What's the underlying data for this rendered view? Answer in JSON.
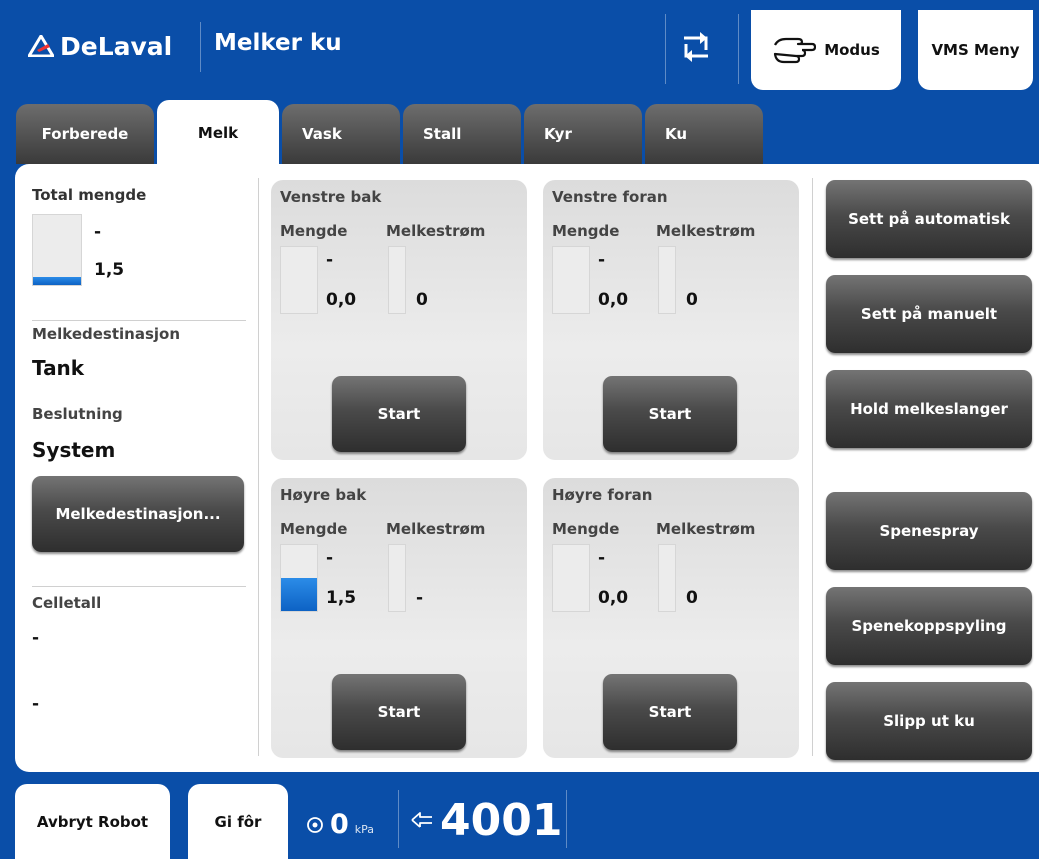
{
  "header": {
    "brand": "DeLaval",
    "title": "Melker ku",
    "modus_label": "Modus",
    "vms_menu_label": "VMS Meny"
  },
  "tabs": [
    {
      "label": "Forberede",
      "active": false
    },
    {
      "label": "Melk",
      "active": true
    },
    {
      "label": "Vask",
      "active": false
    },
    {
      "label": "Stall",
      "active": false
    },
    {
      "label": "Kyr",
      "active": false
    },
    {
      "label": "Ku",
      "active": false
    }
  ],
  "left": {
    "total_label": "Total mengde",
    "total_top": "-",
    "total_value": "1,5",
    "total_fill": 0.12,
    "dest_label": "Melkedestinasjon",
    "dest_value": "Tank",
    "decision_label": "Beslutning",
    "decision_value": "System",
    "dest_button": "Melkedestinasjon...",
    "cell_label": "Celletall",
    "cell_value1": "-",
    "cell_value2": "-"
  },
  "teats": {
    "lr": {
      "title": "Venstre bak",
      "amount_label": "Mengde",
      "flow_label": "Melkestrøm",
      "amount_top": "-",
      "amount": "0,0",
      "flow": "0",
      "amount_fill": 0,
      "start": "Start"
    },
    "lf": {
      "title": "Venstre foran",
      "amount_label": "Mengde",
      "flow_label": "Melkestrøm",
      "amount_top": "-",
      "amount": "0,0",
      "flow": "0",
      "amount_fill": 0,
      "start": "Start"
    },
    "rr": {
      "title": "Høyre bak",
      "amount_label": "Mengde",
      "flow_label": "Melkestrøm",
      "amount_top": "-",
      "amount": "1,5",
      "flow": "-",
      "amount_fill": 0.5,
      "start": "Start"
    },
    "rf": {
      "title": "Høyre foran",
      "amount_label": "Mengde",
      "flow_label": "Melkestrøm",
      "amount_top": "-",
      "amount": "0,0",
      "flow": "0",
      "amount_fill": 0,
      "start": "Start"
    }
  },
  "actions": {
    "auto": "Sett på automatisk",
    "manual": "Sett på manuelt",
    "hold": "Hold melkeslanger",
    "spray": "Spenespray",
    "rinse": "Spenekoppspyling",
    "release": "Slipp ut ku"
  },
  "footer": {
    "abort": "Avbryt Robot",
    "feed": "Gi fôr",
    "pressure": "0",
    "pressure_unit": "kPa",
    "cow_number": "4001"
  },
  "colors": {
    "frame_blue": "#0a4ea8",
    "fill_blue": "#1a72d6"
  }
}
